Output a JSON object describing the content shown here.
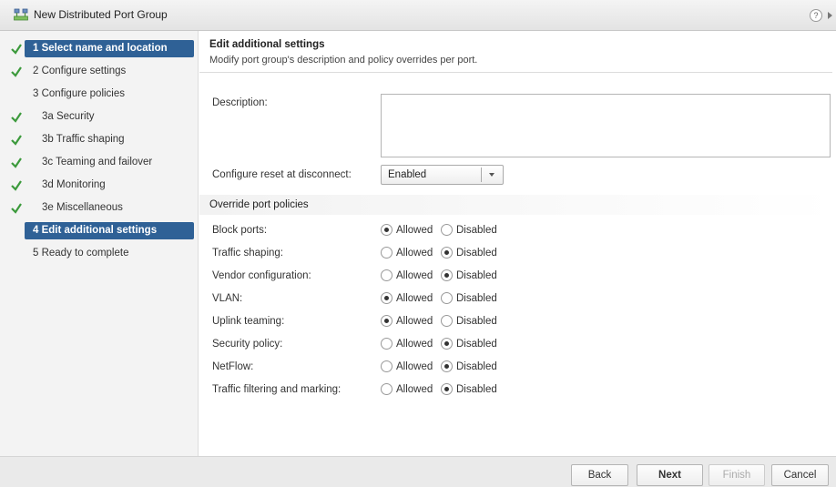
{
  "window": {
    "title": "New Distributed Port Group",
    "help_symbol": "?"
  },
  "steps": [
    {
      "label": "1  Select name and location",
      "checked": true,
      "active": true
    },
    {
      "label": "2  Configure settings",
      "checked": true,
      "active": false
    },
    {
      "label": "3  Configure policies",
      "checked": false,
      "active": false
    },
    {
      "label": "3a  Security",
      "checked": true,
      "active": false
    },
    {
      "label": "3b  Traffic shaping",
      "checked": true,
      "active": false
    },
    {
      "label": "3c  Teaming and failover",
      "checked": true,
      "active": false
    },
    {
      "label": "3d  Monitoring",
      "checked": true,
      "active": false
    },
    {
      "label": "3e  Miscellaneous",
      "checked": true,
      "active": false
    },
    {
      "label": "4  Edit additional settings",
      "checked": false,
      "active": true
    },
    {
      "label": "5  Ready to complete",
      "checked": false,
      "active": false
    }
  ],
  "main": {
    "title": "Edit additional settings",
    "subtitle": "Modify port group's description and policy overrides per port.",
    "description_label": "Description:",
    "description_value": "",
    "reset_label": "Configure reset at disconnect:",
    "reset_value": "Enabled",
    "override_header": "Override port policies",
    "allowed_label": "Allowed",
    "disabled_label": "Disabled",
    "policies": [
      {
        "label": "Block ports:",
        "value": "Allowed"
      },
      {
        "label": "Traffic shaping:",
        "value": "Disabled"
      },
      {
        "label": "Vendor configuration:",
        "value": "Disabled"
      },
      {
        "label": "VLAN:",
        "value": "Allowed"
      },
      {
        "label": "Uplink teaming:",
        "value": "Allowed"
      },
      {
        "label": "Security policy:",
        "value": "Disabled"
      },
      {
        "label": "NetFlow:",
        "value": "Disabled"
      },
      {
        "label": "Traffic filtering and marking:",
        "value": "Disabled"
      }
    ]
  },
  "footer": {
    "back": "Back",
    "next": "Next",
    "finish": "Finish",
    "cancel": "Cancel"
  },
  "colors": {
    "accent": "#2f6196",
    "check": "#3c9a3c"
  },
  "icons": {
    "wizard": "network-port-group-icon",
    "help": "help-icon",
    "check": "check-icon"
  }
}
